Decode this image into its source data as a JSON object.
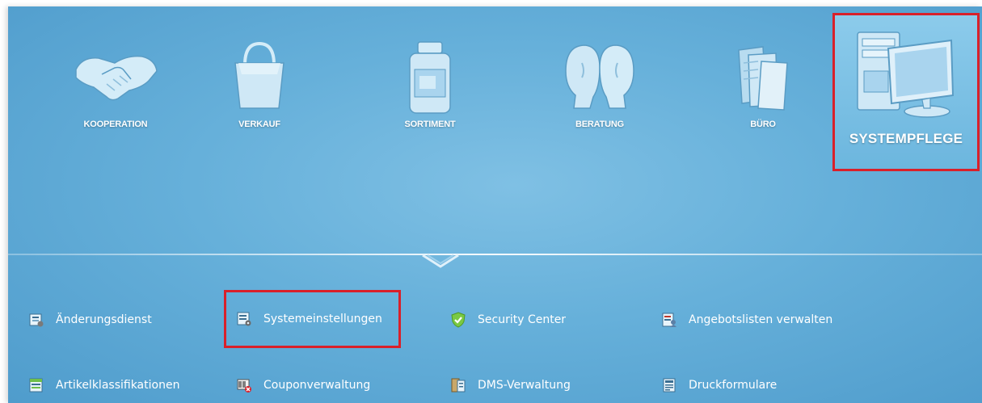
{
  "modules": [
    {
      "label": "KOOPERATION",
      "icon": "handshake-icon"
    },
    {
      "label": "VERKAUF",
      "icon": "shopping-bag-icon"
    },
    {
      "label": "SORTIMENT",
      "icon": "medicine-bottle-icon"
    },
    {
      "label": "BERATUNG",
      "icon": "consultation-heads-icon"
    },
    {
      "label": "BÜRO",
      "icon": "documents-icon"
    },
    {
      "label": "SYSTEMPFLEGE",
      "icon": "computer-icon",
      "active": true
    }
  ],
  "submenu": [
    {
      "label": "Änderungsdienst",
      "icon": "update-service-icon"
    },
    {
      "label": "Systemeinstellungen",
      "icon": "system-settings-icon",
      "highlighted": true
    },
    {
      "label": "Security Center",
      "icon": "shield-check-icon"
    },
    {
      "label": "Angebotslisten verwalten",
      "icon": "offer-lists-icon"
    },
    {
      "label": "Artikelklassifikationen",
      "icon": "article-classification-icon"
    },
    {
      "label": "Couponverwaltung",
      "icon": "coupon-icon"
    },
    {
      "label": "DMS-Verwaltung",
      "icon": "dms-icon"
    },
    {
      "label": "Druckformulare",
      "icon": "print-forms-icon"
    }
  ],
  "colors": {
    "accent_highlight": "#d9202a",
    "background": "#66b0da",
    "text": "#ffffff"
  }
}
